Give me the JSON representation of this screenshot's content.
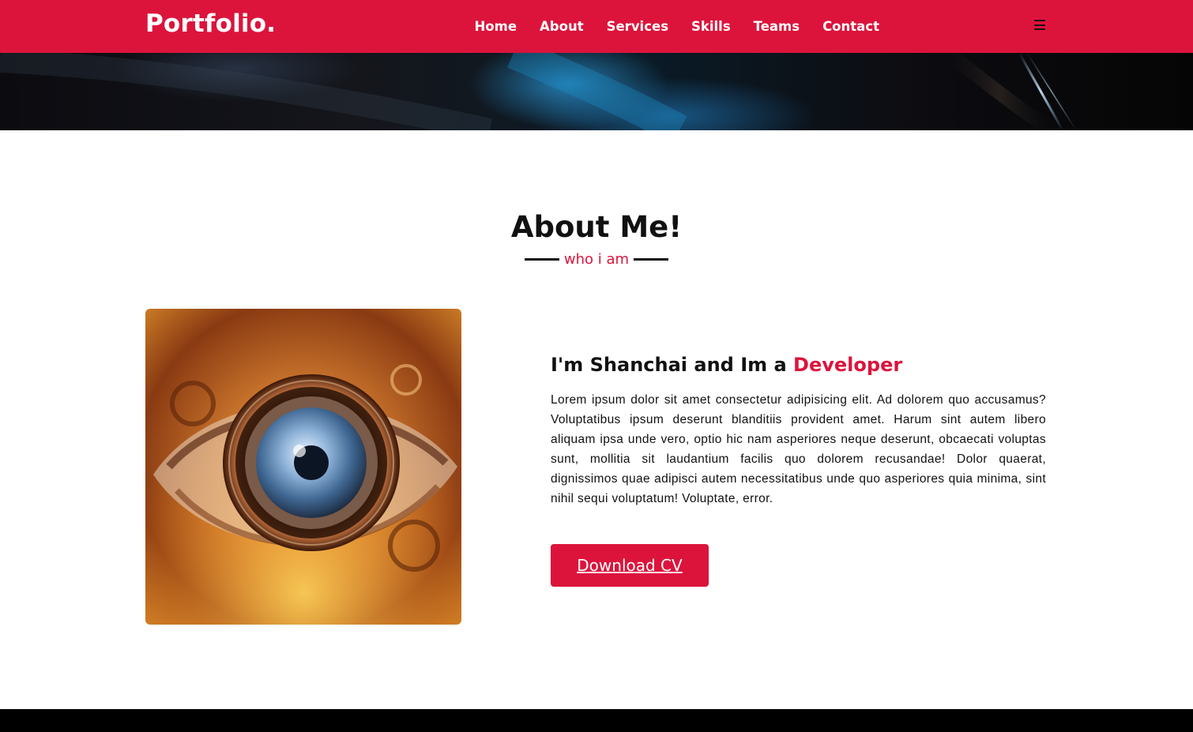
{
  "brand": {
    "logo": "Portfolio.",
    "accent_color": "#dc143c"
  },
  "nav": {
    "items": [
      {
        "label": "Home"
      },
      {
        "label": "About"
      },
      {
        "label": "Services"
      },
      {
        "label": "Skills"
      },
      {
        "label": "Teams"
      },
      {
        "label": "Contact"
      }
    ],
    "menu_icon": "hamburger-menu-icon"
  },
  "about": {
    "title": "About Me!",
    "subtitle": "who i am",
    "image": "eye-camera-lens-artwork",
    "intro_prefix": "I'm Shanchai and Im a ",
    "intro_role": "Developer",
    "paragraph": "Lorem ipsum dolor sit amet consectetur adipisicing elit. Ad dolorem quo accusamus? Voluptatibus ipsum deserunt blanditiis provident amet. Harum sint autem libero aliquam ipsa unde vero, optio hic nam asperiores neque deserunt, obcaecati voluptas sunt, mollitia sit laudantium facilis quo dolorem recusandae! Dolor quaerat, dignissimos quae adipisci autem necessitatibus unde quo asperiores quia minima, sint nihil sequi voluptatum! Voluptate, error.",
    "button_label": "Download CV"
  }
}
